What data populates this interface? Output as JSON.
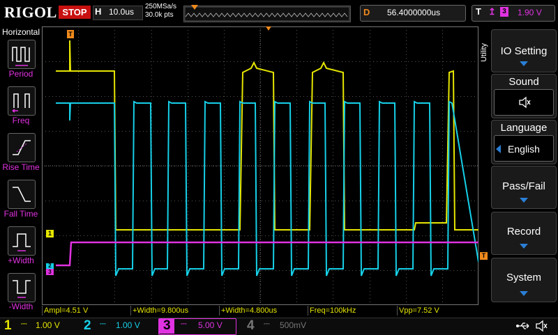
{
  "topbar": {
    "brand": "RIGOL",
    "run_state": "STOP",
    "horizontal_label": "H",
    "time_base": "10.0us",
    "sample_rate": "250MSa/s",
    "memory_depth": "30.0k pts",
    "delay_label": "D",
    "delay_value": "56.4000000us",
    "trigger_label": "T",
    "trigger_edge": "rising",
    "trigger_source": "3",
    "trigger_level": "1.90 V"
  },
  "left_panel": {
    "title": "Horizontal",
    "items": [
      {
        "label": "Period"
      },
      {
        "label": "Freq"
      },
      {
        "label": "Rise Time"
      },
      {
        "label": "Fall Time"
      },
      {
        "label": "+Width"
      },
      {
        "label": "-Width"
      }
    ]
  },
  "right_panel": {
    "utility_label": "Utility",
    "io_setting": "IO Setting",
    "sound": "Sound",
    "language": "Language",
    "language_value": "English",
    "pass_fail": "Pass/Fail",
    "record": "Record",
    "system": "System"
  },
  "markers": {
    "ch1": "1",
    "ch2": "2",
    "ch3": "3",
    "trigger_level_marker": "T"
  },
  "measurements": [
    "Ampl=4.51 V",
    "+Width=9.800us",
    "+Width=4.800us",
    "Freq=100kHz",
    "Vpp=7.52 V"
  ],
  "channels": [
    {
      "num": "1",
      "scale": "1.00 V",
      "color": "#e6e600"
    },
    {
      "num": "2",
      "scale": "1.00 V",
      "color": "#00c8e6"
    },
    {
      "num": "3",
      "scale": "5.00 V",
      "color": "#e032e0"
    },
    {
      "num": "4",
      "scale": "500mV",
      "color": "#777777"
    }
  ],
  "colors": {
    "ch1": "#e6e600",
    "ch2": "#16d0e8",
    "ch3": "#e032e0",
    "accent": "#f08a1c",
    "stop": "#c81010"
  },
  "icons": [
    "usb-icon",
    "speaker-icon",
    "chevron-down-icon"
  ]
}
